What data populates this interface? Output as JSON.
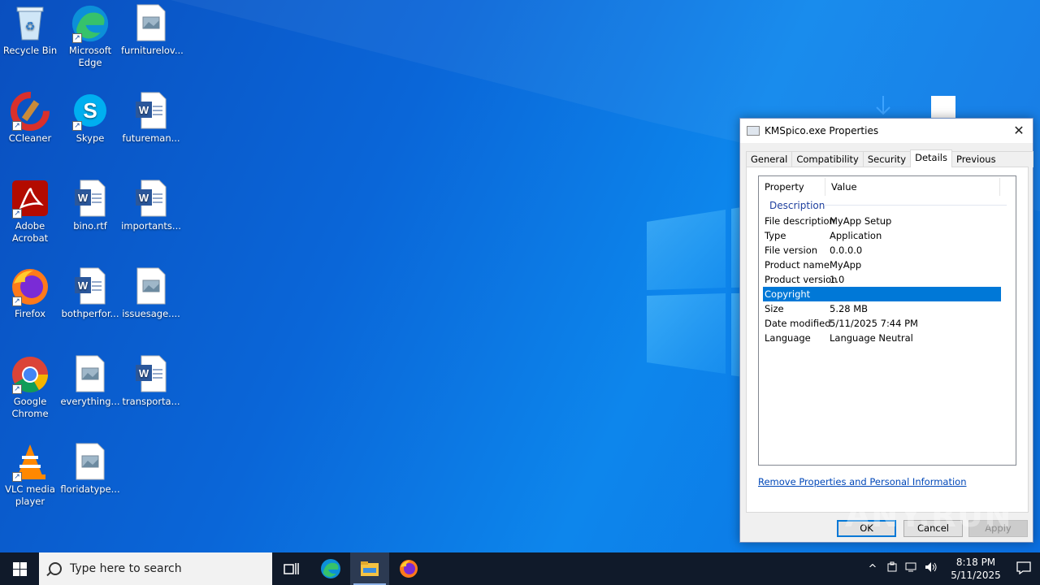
{
  "desktop_icons": [
    {
      "name": "recycle-bin-icon",
      "label": "Recycle Bin"
    },
    {
      "name": "edge-icon",
      "label": "Microsoft Edge"
    },
    {
      "name": "image-file-icon",
      "label": "furniturelov..."
    },
    {
      "name": "ccleaner-icon",
      "label": "CCleaner"
    },
    {
      "name": "skype-icon",
      "label": "Skype"
    },
    {
      "name": "word-file-icon",
      "label": "futureman..."
    },
    {
      "name": "acrobat-icon",
      "label": "Adobe Acrobat"
    },
    {
      "name": "word-file-icon",
      "label": "bino.rtf"
    },
    {
      "name": "word-file-icon",
      "label": "importants..."
    },
    {
      "name": "firefox-icon",
      "label": "Firefox"
    },
    {
      "name": "word-file-icon",
      "label": "bothperfor..."
    },
    {
      "name": "image-file-icon",
      "label": "issuesage...."
    },
    {
      "name": "chrome-icon",
      "label": "Google Chrome"
    },
    {
      "name": "image-file-icon",
      "label": "everything..."
    },
    {
      "name": "word-file-icon",
      "label": "transporta..."
    },
    {
      "name": "vlc-icon",
      "label": "VLC media player"
    },
    {
      "name": "image-file-icon",
      "label": "floridatype..."
    }
  ],
  "dialog": {
    "title": "KMSpico.exe Properties",
    "close_glyph": "✕",
    "tabs": [
      "General",
      "Compatibility",
      "Security",
      "Details",
      "Previous Versions"
    ],
    "active_tab": "Details",
    "columns": {
      "property": "Property",
      "value": "Value"
    },
    "group": "Description",
    "rows": [
      {
        "property": "File description",
        "value": "MyApp Setup"
      },
      {
        "property": "Type",
        "value": "Application"
      },
      {
        "property": "File version",
        "value": "0.0.0.0"
      },
      {
        "property": "Product name",
        "value": "MyApp"
      },
      {
        "property": "Product version",
        "value": "1.0"
      },
      {
        "property": "Copyright",
        "value": ""
      },
      {
        "property": "Size",
        "value": "5.28 MB"
      },
      {
        "property": "Date modified",
        "value": "5/11/2025 7:44 PM"
      },
      {
        "property": "Language",
        "value": "Language Neutral"
      }
    ],
    "selected_row": "Copyright",
    "link": "Remove Properties and Personal Information",
    "buttons": {
      "ok": "OK",
      "cancel": "Cancel",
      "apply": "Apply"
    }
  },
  "watermark": "ANY.RUN",
  "taskbar": {
    "search_placeholder": "Type here to search",
    "pinned": [
      "task-view-icon",
      "edge-icon",
      "file-explorer-icon",
      "firefox-icon"
    ],
    "active": "file-explorer-icon",
    "tray": {
      "chevron": "^",
      "time": "8:18 PM",
      "date": "5/11/2025"
    }
  }
}
